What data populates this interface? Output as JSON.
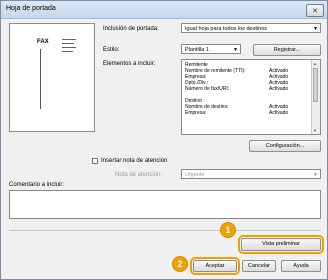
{
  "window": {
    "title": "Hoja de portada"
  },
  "preview": {
    "mark": "FAX"
  },
  "form": {
    "inclusion_label": "Inclusión de portada:",
    "inclusion_value": "Igual hoja para todos los destinos",
    "estilo_label": "Estilo:",
    "estilo_value": "Plantilla 1",
    "registrar": "Registrar...",
    "elements_label": "Elementos a incluir:",
    "elements": [
      {
        "name": "Remitente",
        "value": ""
      },
      {
        "name": "Nombre de remitente (TTI):",
        "value": "Activado"
      },
      {
        "name": "Empresa:",
        "value": "Activado"
      },
      {
        "name": "Dpto./Div.:",
        "value": "Activado"
      },
      {
        "name": "Número de fax/URI:",
        "value": "Activado"
      },
      {
        "name": "",
        "value": ""
      },
      {
        "name": "Destino",
        "value": ""
      },
      {
        "name": "Nombre de destino:",
        "value": "Activado"
      },
      {
        "name": "Empresa:",
        "value": "Activado"
      }
    ],
    "configuracion": "Configuración...",
    "insert_attention": "Insertar nota de atención",
    "nota_label": "Nota de atención:",
    "nota_value": "Urgente",
    "comment_label": "Comentario a incluir:"
  },
  "buttons": {
    "preview": "Vista preliminar",
    "accept": "Aceptar",
    "cancel": "Cancelar",
    "help": "Ayuda"
  },
  "callouts": {
    "one": "1",
    "two": "2"
  },
  "colors": {
    "accent": "#f0a000"
  }
}
